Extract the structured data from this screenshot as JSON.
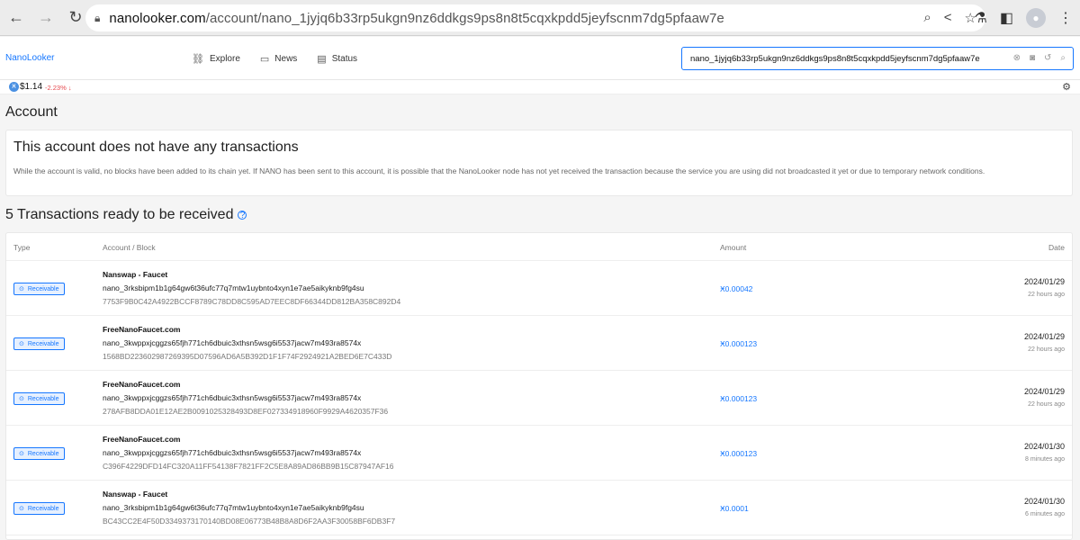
{
  "browser": {
    "url_host": "nanolooker.com",
    "url_path": "/account/nano_1jyjq6b33rp5ukgn9nz6ddkgs9ps8n8t5cqxkpdd5jeyfscnm7dg5pfaaw7e"
  },
  "site": {
    "brand": "NanoLooker",
    "nav": {
      "explore": "Explore",
      "news": "News",
      "status": "Status"
    },
    "search_value": "nano_1jyjq6b33rp5ukgn9nz6ddkgs9ps8n8t5cqxkpdd5jeyfscnm7dg5pfaaw7e"
  },
  "price": {
    "value": "$1.14",
    "change": "-2.23% ↓"
  },
  "account": {
    "heading": "Account",
    "empty_title": "This account does not have any transactions",
    "empty_desc": "While the account is valid, no blocks have been added to its chain yet. If NANO has been sent to this account, it is possible that the NanoLooker node has not yet received the transaction because the service you are using did not broadcasted it yet or due to temporary network conditions."
  },
  "receivable": {
    "heading": "5 Transactions ready to be received",
    "columns": {
      "type": "Type",
      "account": "Account / Block",
      "amount": "Amount",
      "date": "Date"
    },
    "rows": [
      {
        "type": "Receivable",
        "alias": "Nanswap - Faucet",
        "account": "nano_3rksbipm1b1g64gw6t36ufc77q7mtw1uybnto4xyn1e7ae5aikyknb9fg4su",
        "hash": "7753F9B0C42A4922BCCF8789C78DD8C595AD7EEC8DF66344DD812BA358C892D4",
        "amount": "Ӿ0.00042",
        "date": "2024/01/29",
        "ago": "22 hours ago"
      },
      {
        "type": "Receivable",
        "alias": "FreeNanoFaucet.com",
        "account": "nano_3kwppxjcggzs65fjh771ch6dbuic3xthsn5wsg6i5537jacw7m493ra8574x",
        "hash": "1568BD223602987269395D07596AD6A5B392D1F1F74F2924921A2BED6E7C433D",
        "amount": "Ӿ0.000123",
        "date": "2024/01/29",
        "ago": "22 hours ago"
      },
      {
        "type": "Receivable",
        "alias": "FreeNanoFaucet.com",
        "account": "nano_3kwppxjcggzs65fjh771ch6dbuic3xthsn5wsg6i5537jacw7m493ra8574x",
        "hash": "278AFB8DDA01E12AE2B0091025328493D8EF027334918960F9929A4620357F36",
        "amount": "Ӿ0.000123",
        "date": "2024/01/29",
        "ago": "22 hours ago"
      },
      {
        "type": "Receivable",
        "alias": "FreeNanoFaucet.com",
        "account": "nano_3kwppxjcggzs65fjh771ch6dbuic3xthsn5wsg6i5537jacw7m493ra8574x",
        "hash": "C396F4229DFD14FC320A11FF54138F7821FF2C5E8A89AD86BB9B15C87947AF16",
        "amount": "Ӿ0.000123",
        "date": "2024/01/30",
        "ago": "8 minutes ago"
      },
      {
        "type": "Receivable",
        "alias": "Nanswap - Faucet",
        "account": "nano_3rksbipm1b1g64gw6t36ufc77q7mtw1uybnto4xyn1e7ae5aikyknb9fg4su",
        "hash": "BC43CC2E4F50D3349373170140BD08E06773B48B8A8D6F2AA3F30058BF6DB3F7",
        "amount": "Ӿ0.0001",
        "date": "2024/01/30",
        "ago": "6 minutes ago"
      }
    ]
  },
  "colors": {
    "accent": "#1677ff",
    "negative": "#e5484d"
  }
}
